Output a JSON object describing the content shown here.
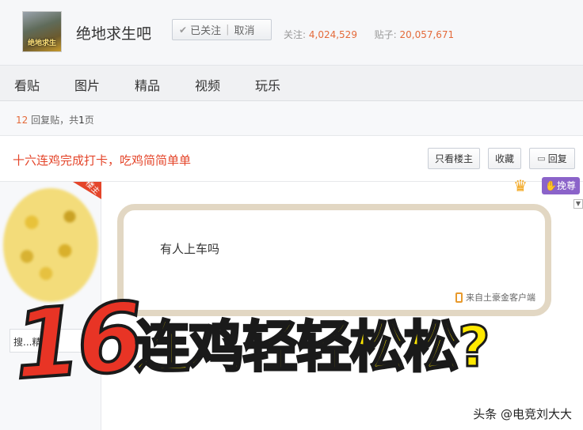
{
  "header": {
    "forum_name": "绝地求生吧",
    "logo_text": "绝地求生",
    "follow_button": {
      "followed_label": "已关注",
      "separator": "|",
      "cancel_label": "取消"
    },
    "stats": {
      "followers_label": "关注:",
      "followers": "4,024,529",
      "posts_label": "贴子:",
      "posts": "20,057,671"
    }
  },
  "nav": {
    "tabs": [
      "看贴",
      "图片",
      "精品",
      "视频",
      "玩乐"
    ]
  },
  "reply_bar": {
    "count": "12",
    "text": "回复贴，共",
    "pages": "1",
    "page_suffix": "页"
  },
  "thread": {
    "title": "十六连鸡完成打卡，吃鸡简简单单",
    "buttons": {
      "only_op": "只看楼主",
      "favorite": "收藏",
      "reply": "回复"
    }
  },
  "user": {
    "badge": "楼主",
    "box_text": "搜...精"
  },
  "post": {
    "fan_badge": {
      "crown_icon": "crown-icon",
      "label": "挽尊"
    },
    "content": "有人上车吗",
    "client": "来自土豪金客户端"
  },
  "overlay": {
    "number": "16",
    "text": "连鸡轻轻松松?"
  },
  "watermark": "头条 @电竞刘大大",
  "colors": {
    "accent_orange": "#e46a3a",
    "title_red": "#e4452a",
    "overlay_yellow": "#ffe800",
    "overlay_red": "#e83425",
    "vip_purple": "#8b63c9"
  }
}
